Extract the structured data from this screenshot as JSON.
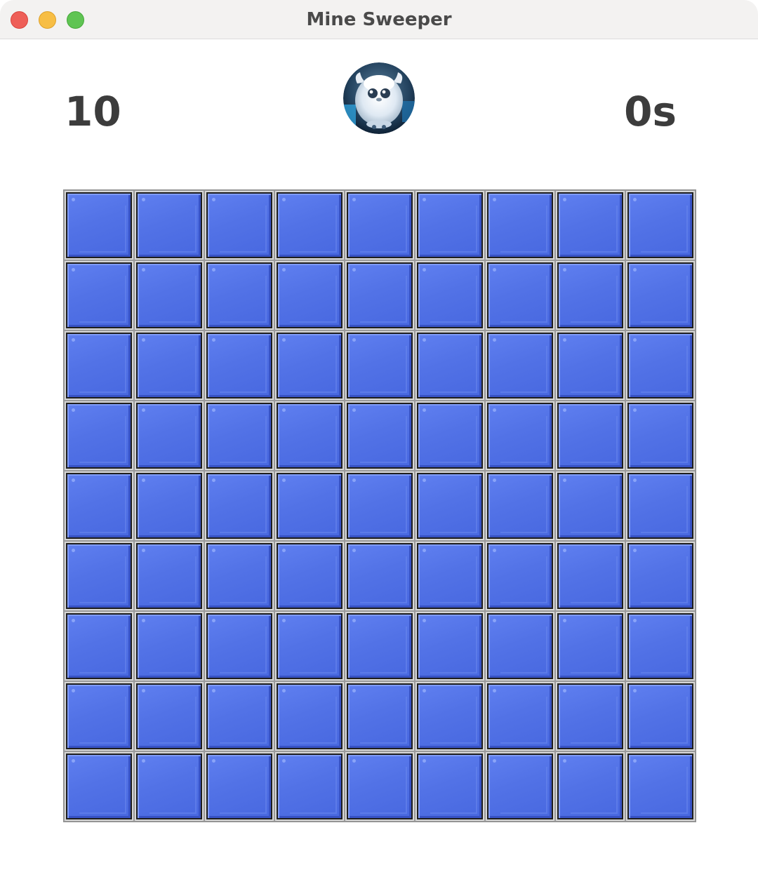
{
  "window": {
    "title": "Mine Sweeper"
  },
  "header": {
    "mines_remaining": "10",
    "timer": "0s",
    "face": {
      "icon": "yeti-face-icon",
      "state": "playing"
    }
  },
  "board": {
    "rows": 9,
    "columns": 9,
    "cell_state": "unrevealed",
    "cell_color": "#5272e6"
  }
}
